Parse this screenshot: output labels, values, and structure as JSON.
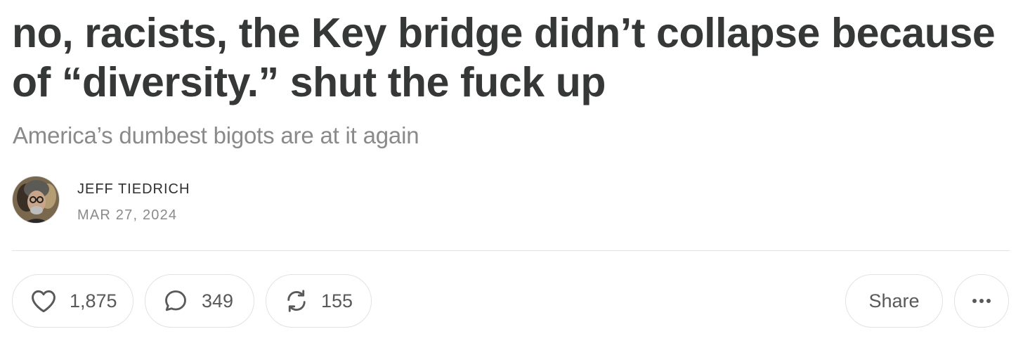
{
  "post": {
    "title": "no, racists, the Key bridge didn’t collapse because of “diversity.” shut the fuck up",
    "subtitle": "America’s dumbest bigots are at it again",
    "author": "JEFF TIEDRICH",
    "date": "MAR 27, 2024"
  },
  "actions": {
    "like": {
      "icon": "heart-icon",
      "count": "1,875"
    },
    "comment": {
      "icon": "speech-bubble-icon",
      "count": "349"
    },
    "restack": {
      "icon": "restack-arrows-icon",
      "count": "155"
    },
    "share": {
      "label": "Share"
    },
    "more": {
      "icon": "ellipsis-icon"
    }
  },
  "colors": {
    "title": "#363737",
    "muted": "#8a8a8a",
    "icon": "#595959",
    "border": "#e2e2e2"
  }
}
